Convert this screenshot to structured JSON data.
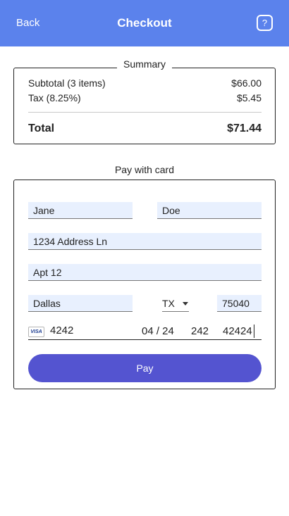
{
  "header": {
    "back_label": "Back",
    "title": "Checkout",
    "help_label": "?"
  },
  "summary": {
    "legend": "Summary",
    "subtotal_label": "Subtotal (3 items)",
    "subtotal_value": "$66.00",
    "tax_label": "Tax (8.25%)",
    "tax_value": "$5.45",
    "total_label": "Total",
    "total_value": "$71.44"
  },
  "payment": {
    "legend": "Pay with card",
    "first_name": "Jane",
    "last_name": "Doe",
    "address_line1": "1234 Address Ln",
    "address_line2": "Apt 12",
    "city": "Dallas",
    "state": "TX",
    "zip": "75040",
    "card": {
      "brand_icon": "visa-icon",
      "brand_label": "VISA",
      "number": "4242",
      "expiry": "04 / 24",
      "cvc": "242",
      "postal": "42424"
    },
    "pay_label": "Pay"
  },
  "colors": {
    "header_bg": "#5b82ec",
    "field_bg": "#e8f0fe",
    "pay_button_bg": "#5454d0"
  }
}
